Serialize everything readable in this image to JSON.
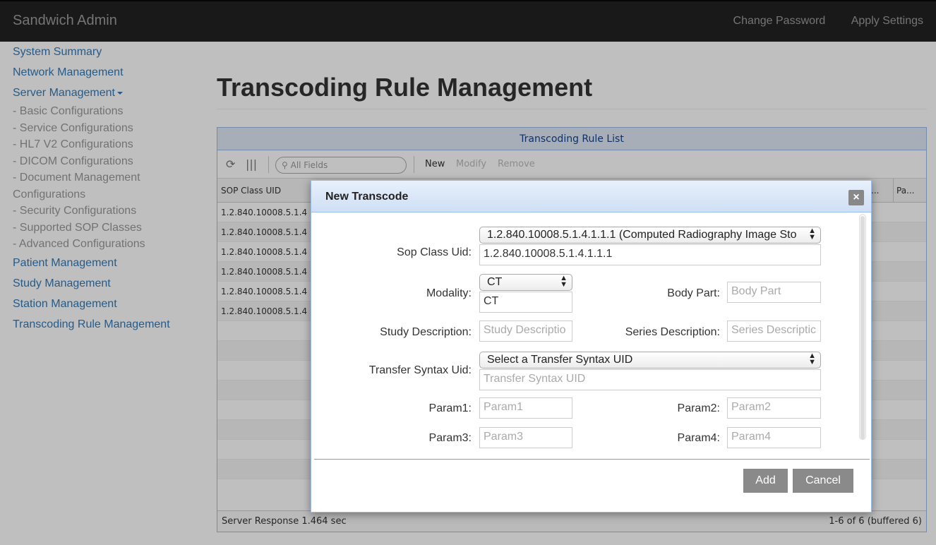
{
  "app": {
    "brand": "Sandwich Admin"
  },
  "nav": {
    "change_password": "Change Password",
    "apply_settings": "Apply Settings"
  },
  "sidebar": {
    "system_summary": "System Summary",
    "network_management": "Network Management",
    "server_management": "Server Management",
    "sub_items": [
      "- Basic Configurations",
      "- Service Configurations",
      "- HL7 V2 Configurations",
      "- DICOM Configurations",
      "- Document Management",
      "Configurations",
      "- Security Configurations",
      "- Supported SOP Classes",
      "- Advanced Configurations"
    ],
    "patient_management": "Patient Management",
    "study_management": "Study Management",
    "station_management": "Station Management",
    "transcoding_rule_management": "Transcoding Rule Management"
  },
  "page": {
    "title": "Transcoding Rule Management"
  },
  "grid": {
    "header": "Transcoding Rule List",
    "search_placeholder": "All Fields",
    "toolbar": {
      "new": "New",
      "modify": "Modify",
      "remove": "Remove"
    },
    "columns": {
      "sop_class_uid": "SOP Class UID",
      "col_ellipsis": "...",
      "col_pa": "Pa..."
    },
    "rows": [
      "1.2.840.10008.5.1.4",
      "1.2.840.10008.5.1.4",
      "1.2.840.10008.5.1.4",
      "1.2.840.10008.5.1.4",
      "1.2.840.10008.5.1.4",
      "1.2.840.10008.5.1.4"
    ],
    "footer_left": "Server Response 1.464 sec",
    "footer_right": "1-6 of 6 (buffered 6)"
  },
  "modal": {
    "title": "New Transcode",
    "close": "×",
    "sop_class_uid_label": "Sop Class Uid:",
    "sop_class_uid_select": "1.2.840.10008.5.1.4.1.1.1 (Computed Radiography Image Sto",
    "sop_class_uid_value": "1.2.840.10008.5.1.4.1.1.1",
    "modality_label": "Modality:",
    "modality_select": "CT",
    "modality_value": "CT",
    "body_part_label": "Body Part:",
    "body_part_placeholder": "Body Part",
    "study_description_label": "Study Description:",
    "study_description_placeholder": "Study Descriptio",
    "series_description_label": "Series Description:",
    "series_description_placeholder": "Series Descriptic",
    "transfer_syntax_label": "Transfer Syntax Uid:",
    "transfer_syntax_select": "Select a Transfer Syntax UID",
    "transfer_syntax_placeholder": "Transfer Syntax UID",
    "param1_label": "Param1:",
    "param1_placeholder": "Param1",
    "param2_label": "Param2:",
    "param2_placeholder": "Param2",
    "param3_label": "Param3:",
    "param3_placeholder": "Param3",
    "param4_label": "Param4:",
    "param4_placeholder": "Param4",
    "add_button": "Add",
    "cancel_button": "Cancel"
  }
}
